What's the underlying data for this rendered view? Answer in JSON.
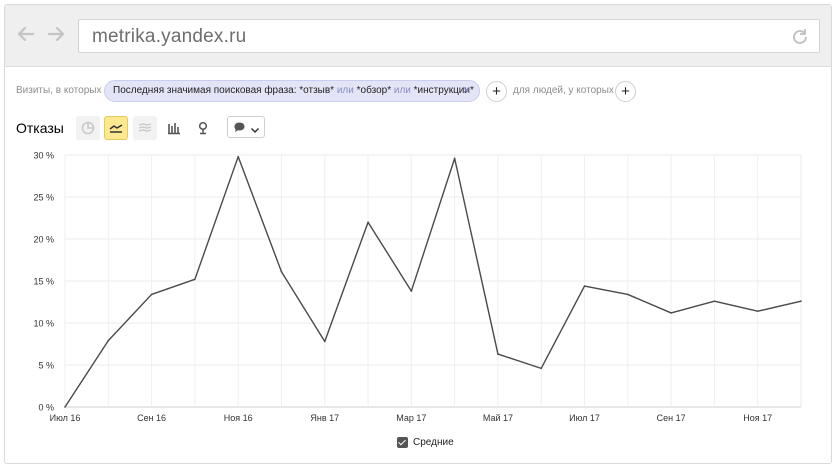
{
  "browser": {
    "url": "metrika.yandex.ru",
    "back_icon": "arrow-left-icon",
    "forward_icon": "arrow-right-icon",
    "reload_icon": "reload-icon"
  },
  "filter": {
    "prefix": "Визиты, в которых",
    "chip_part1": "Последняя значимая поисковая фраза: *отзыв* ",
    "chip_or1": "или",
    "chip_part2": " *обзор* ",
    "chip_or2": "или",
    "chip_part3": " *инструкции*",
    "chip_close": "✕",
    "add_label": "+",
    "suffix": "для людей, у которых",
    "add_label_2": "+"
  },
  "metric": {
    "title": "Отказы",
    "chart_type_icons": [
      "pie-chart-icon",
      "line-chart-icon",
      "area-chart-icon",
      "bar-chart-icon",
      "map-icon"
    ],
    "active_chart_type": "line-chart-icon",
    "annotation_icon": "comment-icon"
  },
  "legend": {
    "label": "Средние",
    "checked": true
  },
  "colors": {
    "line": "#4a4a4a",
    "active_button": "#fde98f",
    "chip_bg": "#e3e5f7"
  },
  "chart_data": {
    "type": "line",
    "x": [
      "Июл 16",
      "Авг 16",
      "Сен 16",
      "Окт 16",
      "Ноя 16",
      "Дек 16",
      "Янв 17",
      "Фев 17",
      "Мар 17",
      "Апр 17",
      "Май 17",
      "Июн 17",
      "Июл 17",
      "Авг 17",
      "Сен 17",
      "Окт 17",
      "Ноя 17",
      "Дек 17"
    ],
    "series": [
      {
        "values": [
          0,
          7.9,
          13.4,
          15.2,
          29.8,
          16.1,
          7.8,
          22.0,
          13.8,
          29.6,
          6.3,
          4.6,
          14.4,
          13.4,
          11.2,
          12.6,
          11.4,
          12.6
        ]
      }
    ],
    "x_tick_labels": [
      "Июл 16",
      "Сен 16",
      "Ноя 16",
      "Янв 17",
      "Мар 17",
      "Май 17",
      "Июл 17",
      "Сен 17",
      "Ноя 17"
    ],
    "x_tick_indices": [
      0,
      2,
      4,
      6,
      8,
      10,
      12,
      14,
      16
    ],
    "y_tick_labels": [
      "0 %",
      "5 %",
      "10 %",
      "15 %",
      "20 %",
      "25 %",
      "30 %"
    ],
    "y_ticks": [
      0,
      5,
      10,
      15,
      20,
      25,
      30
    ],
    "ylim": [
      0,
      30
    ],
    "grid": true
  }
}
